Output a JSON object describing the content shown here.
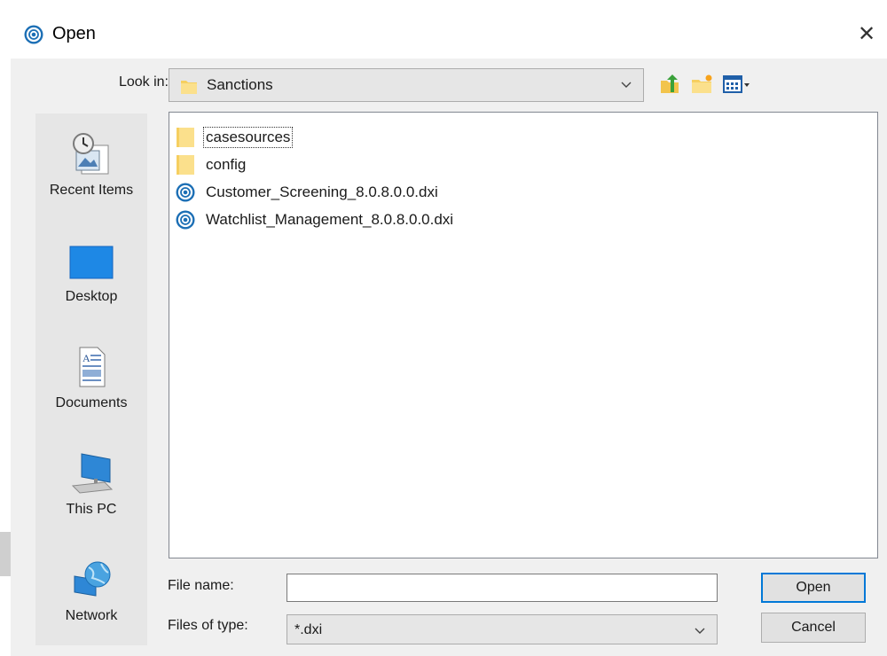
{
  "window": {
    "title": "Open",
    "close_glyph": "✕"
  },
  "look_in": {
    "label": "Look in:",
    "value": "Sanctions"
  },
  "toolbar": {
    "icons": [
      "up-folder-icon",
      "new-folder-icon",
      "view-menu-icon"
    ]
  },
  "places": [
    {
      "label": "Recent Items",
      "icon": "recent-items-icon"
    },
    {
      "label": "Desktop",
      "icon": "desktop-icon"
    },
    {
      "label": "Documents",
      "icon": "documents-icon"
    },
    {
      "label": "This PC",
      "icon": "this-pc-icon"
    },
    {
      "label": "Network",
      "icon": "network-icon"
    }
  ],
  "files": [
    {
      "name": "casesources",
      "type": "folder",
      "focused": true
    },
    {
      "name": "config",
      "type": "folder"
    },
    {
      "name": "Customer_Screening_8.0.8.0.0.dxi",
      "type": "dxi"
    },
    {
      "name": "Watchlist_Management_8.0.8.0.0.dxi",
      "type": "dxi"
    }
  ],
  "file_name": {
    "label": "File name:",
    "value": ""
  },
  "file_type": {
    "label": "Files of type:",
    "value": "*.dxi"
  },
  "buttons": {
    "open": "Open",
    "cancel": "Cancel"
  },
  "colors": {
    "accent": "#0078d7",
    "folder": "#f6cf60",
    "app_icon": "#1c6fb5"
  }
}
